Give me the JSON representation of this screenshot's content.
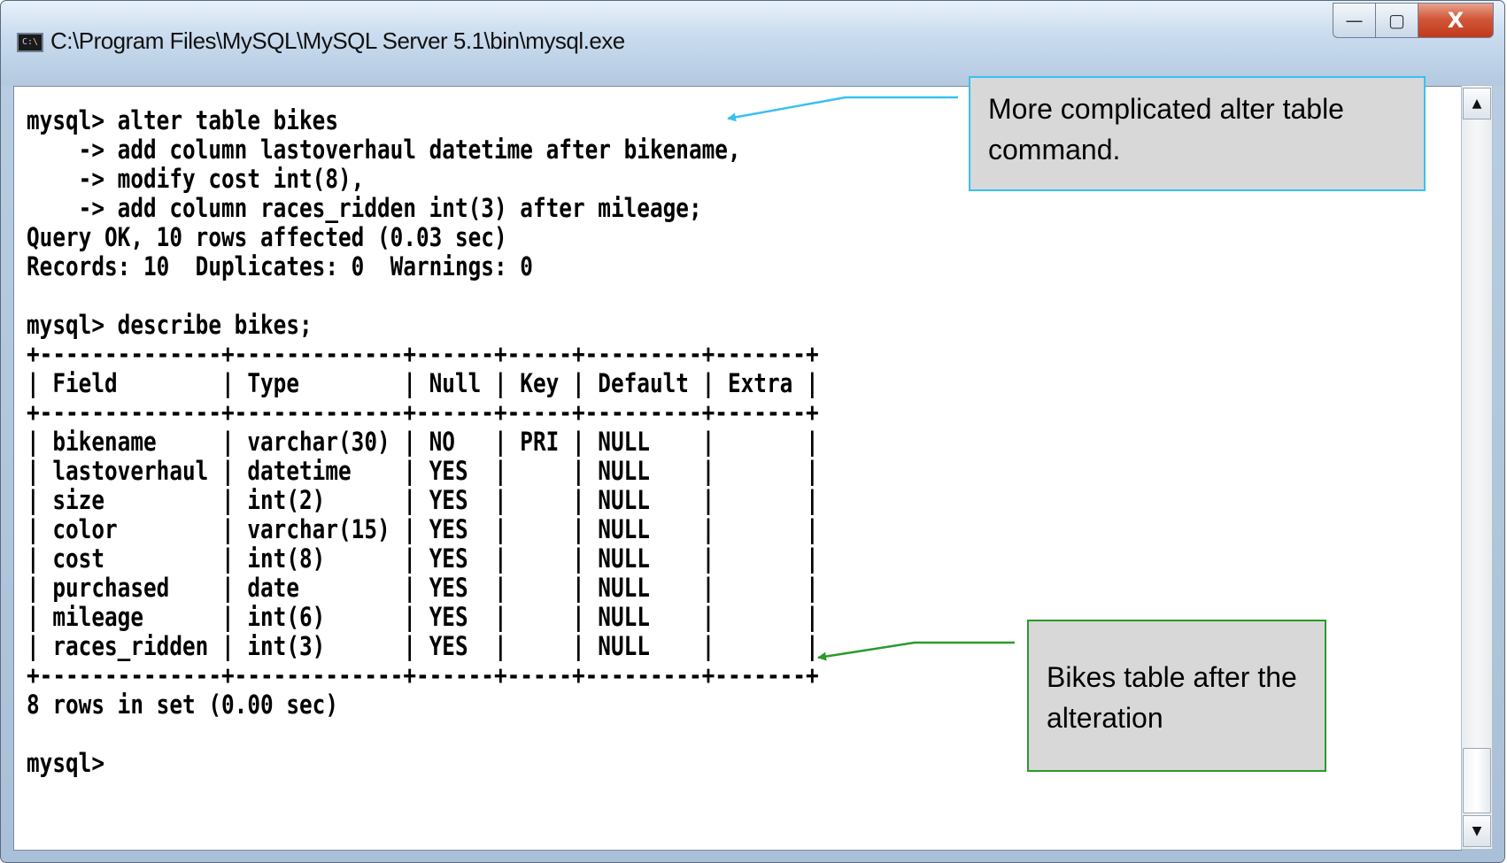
{
  "window": {
    "title": "C:\\Program Files\\MySQL\\MySQL Server 5.1\\bin\\mysql.exe",
    "icon_text": "C:\\",
    "icon": "console-window-icon",
    "controls": {
      "minimize": "—",
      "maximize": "▢",
      "close": "X"
    }
  },
  "console": {
    "lines": [
      "mysql> alter table bikes",
      "    -> add column lastoverhaul datetime after bikename,",
      "    -> modify cost int(8),",
      "    -> add column races_ridden int(3) after mileage;",
      "Query OK, 10 rows affected (0.03 sec)",
      "Records: 10  Duplicates: 0  Warnings: 0",
      "",
      "mysql> describe bikes;",
      "+--------------+-------------+------+-----+---------+-------+",
      "| Field        | Type        | Null | Key | Default | Extra |",
      "+--------------+-------------+------+-----+---------+-------+",
      "| bikename     | varchar(30) | NO   | PRI | NULL    |       |",
      "| lastoverhaul | datetime    | YES  |     | NULL    |       |",
      "| size         | int(2)      | YES  |     | NULL    |       |",
      "| color        | varchar(15) | YES  |     | NULL    |       |",
      "| cost         | int(8)      | YES  |     | NULL    |       |",
      "| purchased    | date        | YES  |     | NULL    |       |",
      "| mileage      | int(6)      | YES  |     | NULL    |       |",
      "| races_ridden | int(3)      | YES  |     | NULL    |       |",
      "+--------------+-------------+------+-----+---------+-------+",
      "8 rows in set (0.00 sec)",
      "",
      "mysql>"
    ]
  },
  "scrollbar": {
    "up_arrow": "▲",
    "down_arrow": "▼"
  },
  "annotations": {
    "callout_1": "More complicated alter table command.",
    "callout_2": "Bikes table after the alteration",
    "callout_1_color": "#39c1ee",
    "callout_2_color": "#2a9a2a"
  }
}
